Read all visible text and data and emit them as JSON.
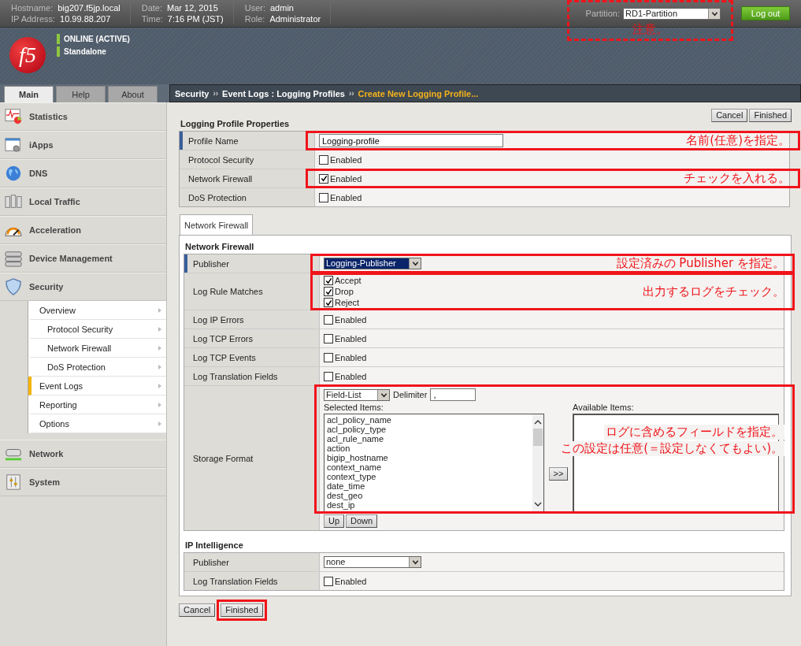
{
  "top_bar": {
    "info": [
      {
        "label": "Hostname:",
        "value": "big207.f5jp.local"
      },
      {
        "label": "IP Address:",
        "value": "10.99.88.207"
      },
      {
        "label": "Date:",
        "value": "Mar 12, 2015"
      },
      {
        "label": "Time:",
        "value": "7:16 PM (JST)"
      },
      {
        "label": "User:",
        "value": "admin"
      },
      {
        "label": "Role:",
        "value": "Administrator"
      }
    ],
    "partition_label": "Partition:",
    "partition": "RD1-Partition",
    "partition_annotation": "注意。",
    "logout": "Log out"
  },
  "logo": "f5",
  "status": [
    "ONLINE (ACTIVE)",
    "Standalone"
  ],
  "nav_tabs": [
    {
      "label": "Main",
      "selected": true
    },
    {
      "label": "Help",
      "selected": false
    },
    {
      "label": "About",
      "selected": false
    }
  ],
  "breadcrumb": [
    {
      "text": "Security",
      "current": false
    },
    {
      "text": "Event Logs : Logging Profiles",
      "current": false
    },
    {
      "text": "Create New Logging Profile...",
      "current": true
    }
  ],
  "breadcrumb_separator": "››",
  "sidebar": [
    {
      "label": "Statistics"
    },
    {
      "label": "iApps"
    },
    {
      "label": "DNS"
    },
    {
      "label": "Local Traffic"
    },
    {
      "label": "Acceleration"
    },
    {
      "label": "Device Management"
    },
    {
      "label": "Security",
      "children": [
        {
          "label": "Overview",
          "selected": false,
          "children": [
            {
              "label": "Protocol Security",
              "selected": false
            },
            {
              "label": "Network Firewall",
              "selected": false
            },
            {
              "label": "DoS Protection",
              "selected": false
            }
          ]
        },
        {
          "label": "Event Logs",
          "selected": true
        },
        {
          "label": "Reporting",
          "selected": false
        },
        {
          "label": "Options",
          "selected": false
        }
      ]
    },
    {
      "label": "Network"
    },
    {
      "label": "System"
    }
  ],
  "top_buttons": [
    "Cancel",
    "Finished"
  ],
  "properties": {
    "title": "Logging Profile Properties",
    "rows": [
      {
        "label": "Profile Name",
        "kind": "text",
        "focused": true,
        "value": "Logging-profile",
        "annotation": "名前(任意)を指定。"
      },
      {
        "label": "Protocol Security",
        "kind": "checkbox",
        "focused": false,
        "option": "Enabled",
        "checked": false
      },
      {
        "label": "Network Firewall",
        "kind": "checkbox",
        "focused": false,
        "option": "Enabled",
        "checked": true,
        "annotation": "チェックを入れる。"
      },
      {
        "label": "DoS Protection",
        "kind": "checkbox",
        "focused": false,
        "option": "Enabled",
        "checked": false
      }
    ]
  },
  "panel_tabs": [
    {
      "label": "Network Firewall",
      "selected": true
    }
  ],
  "sections": [
    {
      "title": "Network Firewall",
      "rows": [
        {
          "label": "Publisher",
          "kind": "select",
          "value": "Logging-Publisher",
          "focused": true,
          "annotation": "設定済みの Publisher を指定。"
        },
        {
          "label": "Log Rule Matches",
          "kind": "checklist",
          "options": [
            {
              "label": "Accept",
              "checked": true
            },
            {
              "label": "Drop",
              "checked": true
            },
            {
              "label": "Reject",
              "checked": true
            }
          ],
          "annotation": "出力するログをチェック。"
        },
        {
          "label": "Log IP Errors",
          "kind": "checkbox",
          "option": "Enabled",
          "checked": false
        },
        {
          "label": "Log TCP Errors",
          "kind": "checkbox",
          "option": "Enabled",
          "checked": false
        },
        {
          "label": "Log TCP Events",
          "kind": "checkbox",
          "option": "Enabled",
          "checked": false
        },
        {
          "label": "Log Translation Fields",
          "kind": "checkbox",
          "option": "Enabled",
          "checked": false
        },
        {
          "label": "Storage Format",
          "kind": "storage",
          "format": "Field-List",
          "delimiter_label": "Delimiter",
          "delimiter": ",",
          "selected_label": "Selected Items:",
          "selected_items": [
            "acl_policy_name",
            "acl_policy_type",
            "acl_rule_name",
            "action",
            "bigip_hostname",
            "context_name",
            "context_type",
            "date_time",
            "dest_geo",
            "dest_ip"
          ],
          "available_label": "Available Items:",
          "move_button": ">>",
          "up": "Up",
          "down": "Down",
          "annotation_lines": [
            "ログに含めるフィールドを指定。",
            "この設定は任意(＝設定しなくてもよい)。"
          ]
        }
      ]
    },
    {
      "title": "IP Intelligence",
      "rows": [
        {
          "label": "Publisher",
          "kind": "select",
          "value": "none",
          "focused": false
        },
        {
          "label": "Log Translation Fields",
          "kind": "checkbox",
          "option": "Enabled",
          "checked": false
        }
      ]
    }
  ],
  "bottom_buttons": [
    {
      "label": "Cancel",
      "annotated": false
    },
    {
      "label": "Finished",
      "annotated": true
    }
  ]
}
